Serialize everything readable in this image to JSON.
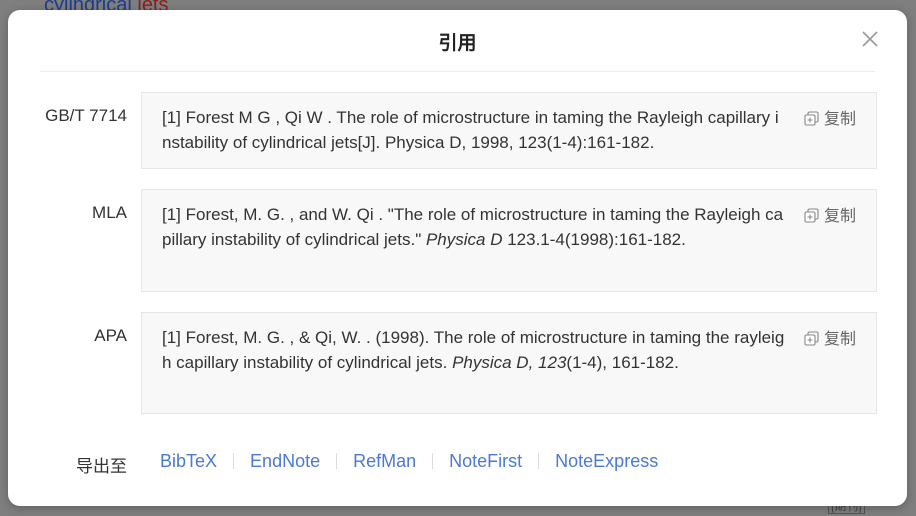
{
  "background": {
    "title_blue": "cylindrical",
    "title_red": " jets",
    "badge": "[期刊]"
  },
  "dialog": {
    "title": "引用",
    "copy_label": "复制",
    "citations": [
      {
        "label": "GB/T 7714",
        "text": "[1] Forest M G , Qi W . The role of microstructure in taming the Rayleigh capillary instability of cylindrical jets[J]. Physica D, 1998, 123(1-4):161-182."
      },
      {
        "label": "MLA",
        "text_before": "[1] Forest, M. G. , and W. Qi . \"The role of microstructure in taming the Rayleigh capillary instability of cylindrical jets.\" ",
        "text_italic": "Physica D",
        "text_after": " 123.1-4(1998):161-182."
      },
      {
        "label": "APA",
        "text_before": "[1] Forest, M. G. , & Qi, W. . (1998). The role of microstructure in taming the rayleigh capillary instability of cylindrical jets. ",
        "text_italic": "Physica D, 123",
        "text_after": "(1-4), 161-182."
      }
    ],
    "export": {
      "label": "导出至",
      "links": [
        "BibTeX",
        "EndNote",
        "RefMan",
        "NoteFirst",
        "NoteExpress"
      ]
    }
  }
}
